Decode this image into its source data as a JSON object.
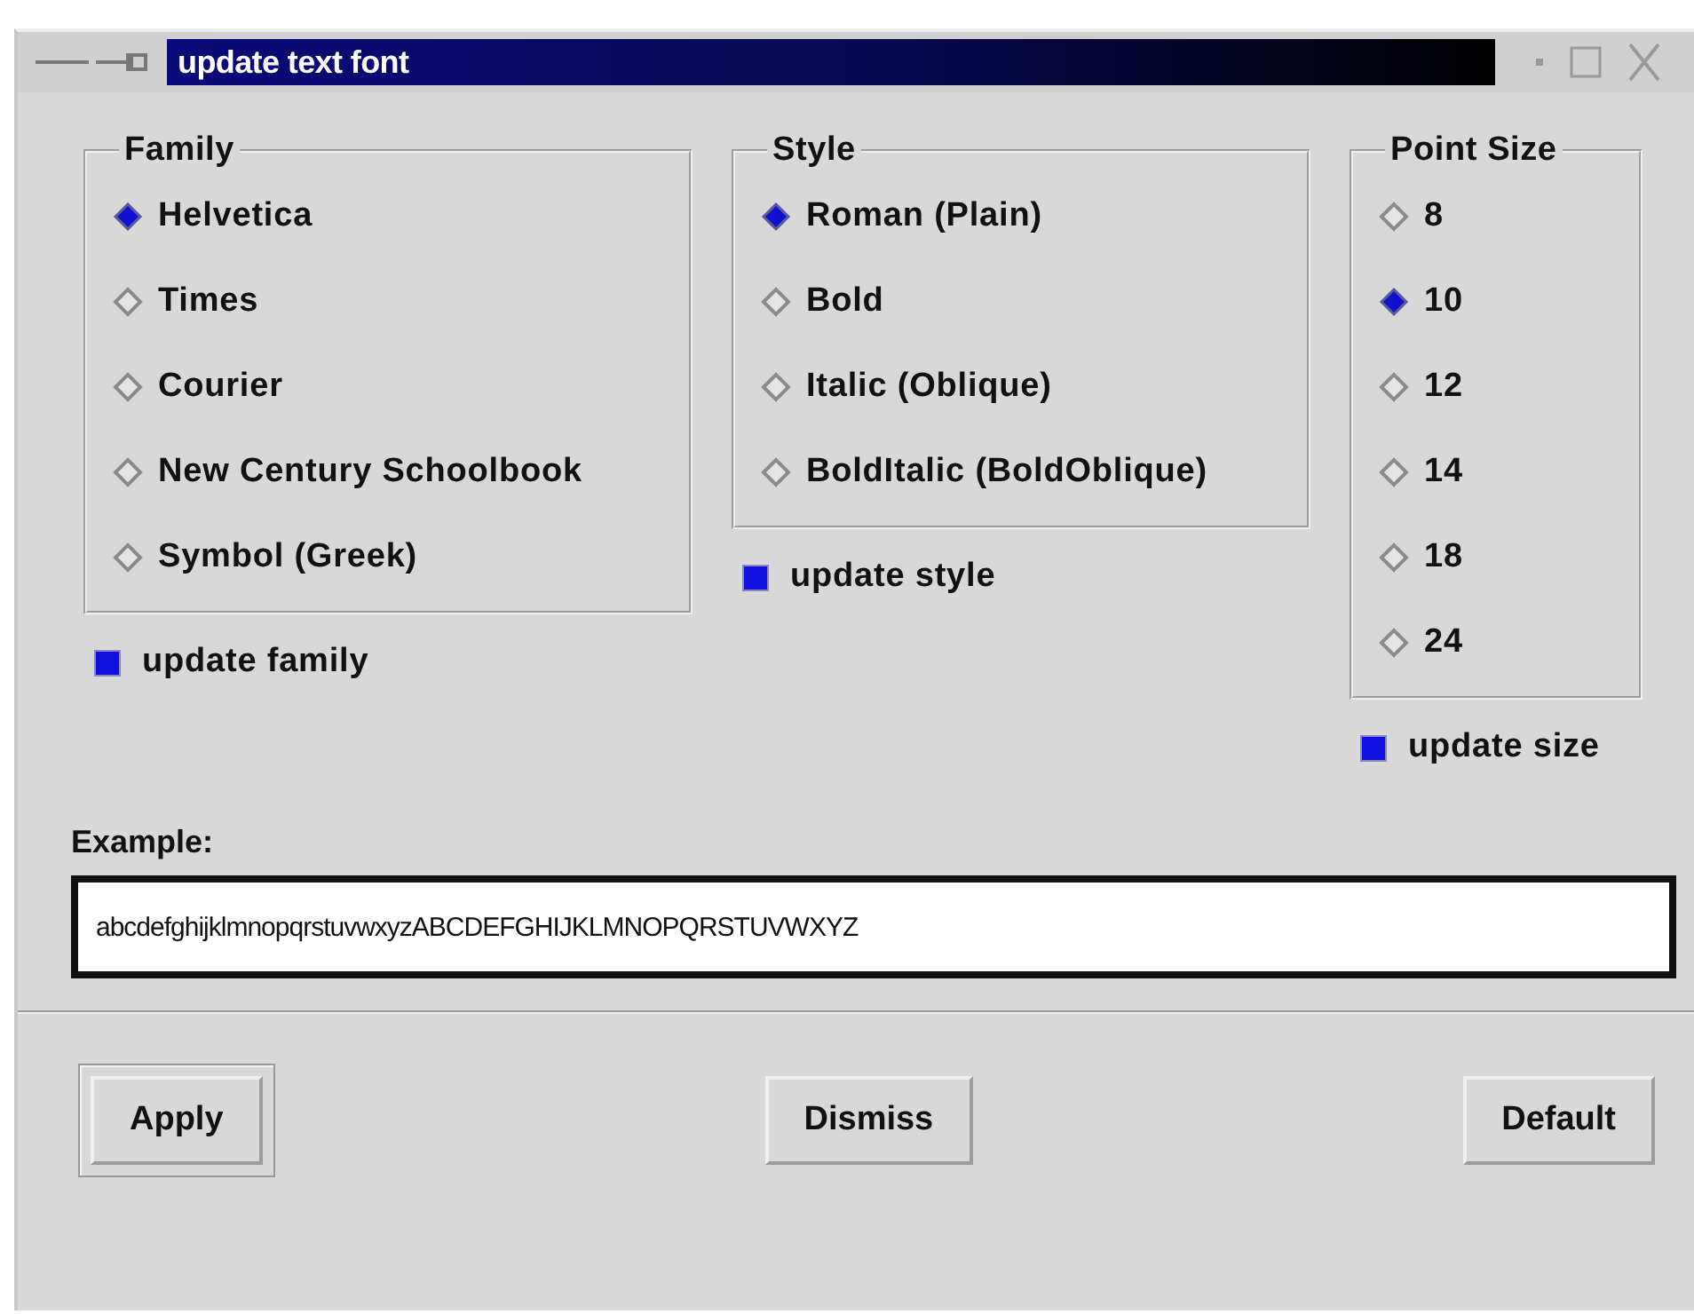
{
  "window": {
    "title": "update text font"
  },
  "groups": [
    {
      "title": "Family",
      "options": [
        {
          "label": "Helvetica",
          "selected": true
        },
        {
          "label": "Times",
          "selected": false
        },
        {
          "label": "Courier",
          "selected": false
        },
        {
          "label": "New Century Schoolbook",
          "selected": false
        },
        {
          "label": "Symbol (Greek)",
          "selected": false
        }
      ],
      "update": {
        "label": "update family",
        "checked": true
      }
    },
    {
      "title": "Style",
      "options": [
        {
          "label": "Roman (Plain)",
          "selected": true
        },
        {
          "label": "Bold",
          "selected": false
        },
        {
          "label": "Italic (Oblique)",
          "selected": false
        },
        {
          "label": "BoldItalic (BoldOblique)",
          "selected": false
        }
      ],
      "update": {
        "label": "update style",
        "checked": true
      }
    },
    {
      "title": "Point Size",
      "options": [
        {
          "label": "8",
          "selected": false
        },
        {
          "label": "10",
          "selected": true
        },
        {
          "label": "12",
          "selected": false
        },
        {
          "label": "14",
          "selected": false
        },
        {
          "label": "18",
          "selected": false
        },
        {
          "label": "24",
          "selected": false
        }
      ],
      "update": {
        "label": "update size",
        "checked": true
      }
    }
  ],
  "example": {
    "label": "Example:",
    "value": "abcdefghijklmnopqrstuvwxyzABCDEFGHIJKLMNOPQRSTUVWXYZ"
  },
  "buttons": [
    {
      "label": "Apply",
      "default": true
    },
    {
      "label": "Dismiss",
      "default": false
    },
    {
      "label": "Default",
      "default": false
    }
  ]
}
